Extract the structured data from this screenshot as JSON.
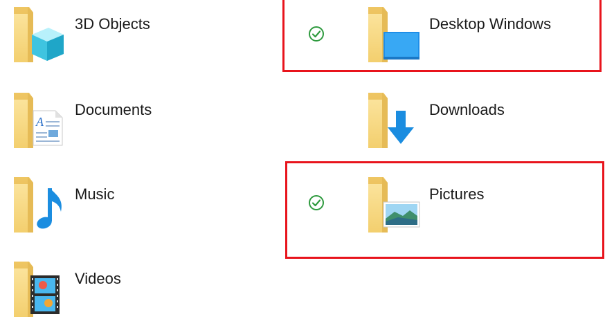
{
  "folders": [
    {
      "label": "3D Objects",
      "icon": "3d-objects-folder-icon",
      "synced": false
    },
    {
      "label": "Desktop Windows",
      "icon": "desktop-folder-icon",
      "synced": true
    },
    {
      "label": "Documents",
      "icon": "documents-folder-icon",
      "synced": false
    },
    {
      "label": "Downloads",
      "icon": "downloads-folder-icon",
      "synced": false
    },
    {
      "label": "Music",
      "icon": "music-folder-icon",
      "synced": false
    },
    {
      "label": "Pictures",
      "icon": "pictures-folder-icon",
      "synced": true
    },
    {
      "label": "Videos",
      "icon": "videos-folder-icon",
      "synced": false
    }
  ],
  "colors": {
    "folder_back": "#e9c46a",
    "folder_front": "#f8dc86",
    "sync_green": "#2e9a3e",
    "highlight_red": "#e8141c"
  }
}
